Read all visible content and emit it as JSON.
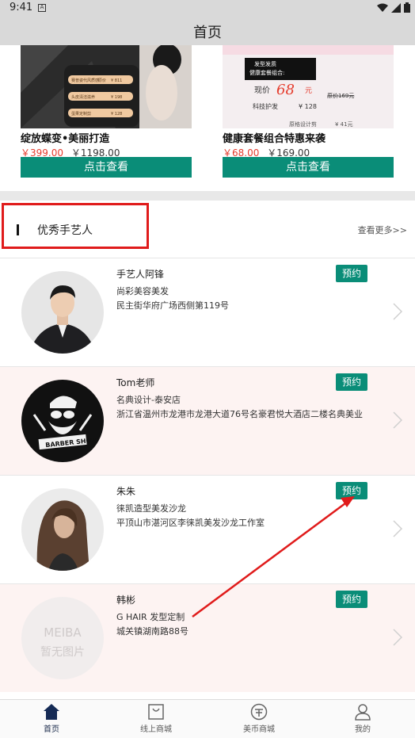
{
  "status_bar": {
    "time": "9:41",
    "a_icon": "A"
  },
  "header": {
    "title": "首页"
  },
  "products": [
    {
      "name": "绽放蝶变•美丽打造",
      "sale_price": "￥399.00",
      "orig_price": "￥1198.00",
      "button": "点击查看",
      "image_lines": [
        "赛普姿代风质感",
        "¥ 811",
        "头皮清洁滋养",
        "¥ 198",
        "蛋果定制剪",
        "¥ 128",
        "原价"
      ]
    },
    {
      "name": "健康套餐组合特惠来袭",
      "sale_price": "￥68.00",
      "orig_price": "￥169.00",
      "button": "点击查看",
      "image_lines": [
        "发型发质",
        "健康套餐组合:",
        "现价",
        "68",
        "元",
        "原价169元",
        "科技护发",
        "¥ 128",
        "原格设计剪",
        "¥ 41元"
      ]
    }
  ],
  "section": {
    "title": "优秀手艺人",
    "more": "查看更多>>"
  },
  "artisans": [
    {
      "name": "手艺人阿锋",
      "shop": "尚彩美容美发",
      "address": "民主街华府广场西侧第119号",
      "button": "预约",
      "avatar_type": "man-photo"
    },
    {
      "name": "Tom老师",
      "shop": "名典设计-泰安店",
      "address": "浙江省温州市龙港市龙港大道76号名豪君悦大酒店二楼名典美业",
      "button": "预约",
      "avatar_type": "barber-logo",
      "avatar_text": "BARBER SHOP"
    },
    {
      "name": "朱朱",
      "shop": "徕凯造型美发沙龙",
      "address": "平顶山市湛河区李徕凯美发沙龙工作室",
      "button": "预约",
      "avatar_type": "woman-photo"
    },
    {
      "name": "韩彬",
      "shop": "G HAIR 发型定制",
      "address": "城关镇湖南路88号",
      "button": "预约",
      "avatar_type": "placeholder",
      "avatar_text": "MEIBA",
      "avatar_subtext": "暂无图片"
    }
  ],
  "bottom_nav": [
    {
      "label": "首页",
      "icon": "home-icon",
      "active": true
    },
    {
      "label": "线上商城",
      "icon": "shop-bag-icon",
      "active": false
    },
    {
      "label": "美币商城",
      "icon": "coin-icon",
      "active": false
    },
    {
      "label": "我的",
      "icon": "user-icon",
      "active": false
    }
  ],
  "colors": {
    "accent": "#0a8d78",
    "price_red": "#e53b2c",
    "highlight_red": "#e01b1b",
    "pink_bg": "#fdf3f2"
  }
}
